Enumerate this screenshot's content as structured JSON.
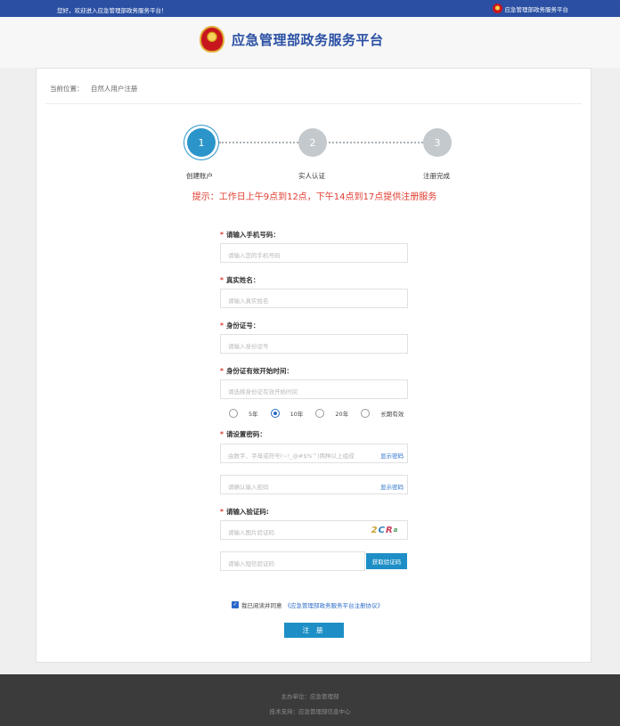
{
  "topbar": {
    "welcome": "您好，欢迎进入应急管理部政务服务平台！",
    "right_text": "应急管理部政务服务平台"
  },
  "header": {
    "title": "应急管理部政务服务平台"
  },
  "breadcrumb": {
    "label": "当前位置：",
    "current": "自然人用户注册"
  },
  "steps": [
    {
      "number": "1",
      "label": "创建账户"
    },
    {
      "number": "2",
      "label": "实人认证"
    },
    {
      "number": "3",
      "label": "注册完成"
    }
  ],
  "notice": "提示：工作日上午9点到12点，下午14点到17点提供注册服务",
  "form": {
    "phone": {
      "label": "请输入手机号码：",
      "placeholder": "请输入您的手机号码"
    },
    "name": {
      "label": "真实姓名：",
      "placeholder": "请输入真实姓名"
    },
    "id_number": {
      "label": "身份证号：",
      "placeholder": "请输入身份证号"
    },
    "id_start": {
      "label": "身份证有效开始时间：",
      "placeholder": "请选择身份证有效开始时间"
    },
    "validity_options": [
      {
        "label": "5年",
        "selected": false
      },
      {
        "label": "10年",
        "selected": true
      },
      {
        "label": "20年",
        "selected": false
      },
      {
        "label": "长期有效",
        "selected": false
      }
    ],
    "password": {
      "label": "请设置密码：",
      "placeholder": "由数字、字母或符号(~!_@#$%^)两种以上组成",
      "show_label": "显示密码"
    },
    "password_confirm": {
      "placeholder": "请确认输入密码",
      "show_label": "显示密码"
    },
    "captcha": {
      "label": "请输入验证码:",
      "placeholder": "请输入图片验证码",
      "text": [
        "2",
        "C",
        "R",
        "a"
      ]
    },
    "sms": {
      "placeholder": "请输入短信验证码",
      "button": "获取验证码"
    },
    "agree": {
      "text": "我已阅读并同意",
      "link": "《应急管理部政务服务平台注册协议》",
      "checked": true
    },
    "submit": "注 册"
  },
  "footer": {
    "sponsor": "主办单位：应急管理部",
    "support": "技术支持：应急管理部信息中心"
  }
}
